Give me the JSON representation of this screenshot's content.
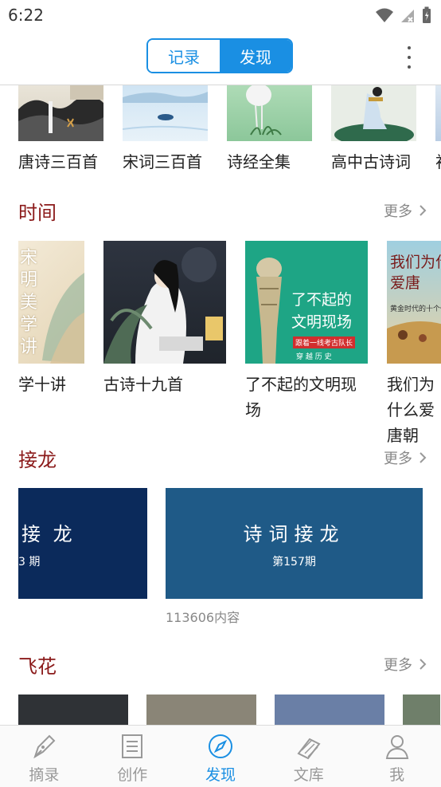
{
  "status": {
    "time": "6:22"
  },
  "header": {
    "tabs": [
      {
        "label": "记录",
        "active": false
      },
      {
        "label": "发现",
        "active": true
      }
    ]
  },
  "top_row": {
    "items": [
      {
        "label": "唐诗三百首"
      },
      {
        "label": "宋词三百首"
      },
      {
        "label": "诗经全集"
      },
      {
        "label": "高中古诗词"
      },
      {
        "label": "初"
      }
    ]
  },
  "time_section": {
    "title": "时间",
    "more": "更多",
    "items": [
      {
        "label": "学十讲",
        "cover_text": "宋明美学讲"
      },
      {
        "label": "古诗十九首"
      },
      {
        "label": "了不起的文明现场",
        "cover_title": "了不起的文明现场",
        "cover_sub": "跟着一线考古队长",
        "cover_tags": "穿 越 历 史"
      },
      {
        "label": "我们为什么爱唐朝",
        "cover_title": "我们为什么爱唐",
        "cover_sub": "黄金时代的十个侧面"
      }
    ]
  },
  "jielong_section": {
    "title": "接龙",
    "more": "更多",
    "items": [
      {
        "title": "接 龙",
        "issue": "3 期"
      },
      {
        "title": "诗词接龙",
        "issue": "第157期",
        "count": "113606内容"
      }
    ]
  },
  "feihua_section": {
    "title": "飞花",
    "more": "更多"
  },
  "bottom_nav": [
    {
      "label": "摘录",
      "icon": "quill-pen-icon",
      "active": false
    },
    {
      "label": "创作",
      "icon": "document-icon",
      "active": false
    },
    {
      "label": "发现",
      "icon": "compass-icon",
      "active": true
    },
    {
      "label": "文库",
      "icon": "books-icon",
      "active": false
    },
    {
      "label": "我",
      "icon": "person-icon",
      "active": false
    }
  ],
  "colors": {
    "accent": "#1a8fe3",
    "section_title": "#8b1a1a",
    "jielong_dark": "#0b2a5b",
    "jielong_blue": "#1f5a87"
  }
}
